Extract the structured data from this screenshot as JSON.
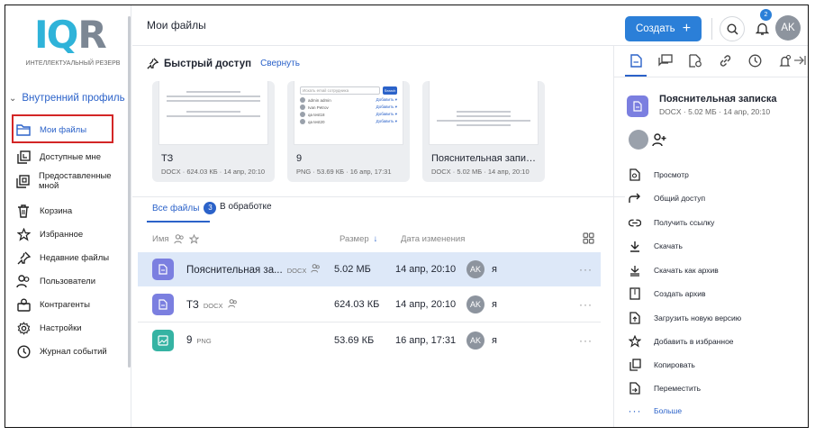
{
  "logo": {
    "mark_left": "IQ",
    "mark_right": "R",
    "subtitle": "Интеллектуальный резерв"
  },
  "sidebar": {
    "section": "Внутренний профиль",
    "items": [
      {
        "label": "Мои файлы",
        "icon": "folder-icon"
      },
      {
        "label": "Доступные мне",
        "icon": "shared-icon"
      },
      {
        "label": "Предоставленные мной",
        "icon": "provided-icon"
      },
      {
        "label": "Корзина",
        "icon": "trash-icon"
      },
      {
        "label": "Избранное",
        "icon": "star-icon"
      },
      {
        "label": "Недавние файлы",
        "icon": "pin-icon"
      },
      {
        "label": "Пользователи",
        "icon": "users-icon"
      },
      {
        "label": "Контрагенты",
        "icon": "counterparty-icon"
      },
      {
        "label": "Настройки",
        "icon": "settings-icon"
      },
      {
        "label": "Журнал событий",
        "icon": "clock-icon"
      }
    ]
  },
  "header": {
    "title": "Мои файлы",
    "create_label": "Создать",
    "notifications_count": "2",
    "user_initials": "AK"
  },
  "quick_access": {
    "title": "Быстрый доступ",
    "collapse_label": "Свернуть",
    "cards": [
      {
        "name": "ТЗ",
        "meta": "DOCX · 624.03 КБ · 14 апр, 20:10"
      },
      {
        "name": "9",
        "meta": "PNG · 53.69 КБ · 16 апр, 17:31",
        "preview": {
          "search_placeholder": "Искать email сотрудника",
          "search_button": "Search",
          "rows": [
            {
              "name": "admin admin",
              "link": "Добавить ▾"
            },
            {
              "name": "Ivan Petrov",
              "link": "Добавить ▾"
            },
            {
              "name": "qa test18",
              "link": "Добавить ▾"
            },
            {
              "name": "qa test20",
              "link": "Добавить ▾"
            }
          ]
        }
      },
      {
        "name": "Пояснительная записка",
        "meta": "DOCX · 5.02 МБ · 14 апр, 20:10"
      }
    ]
  },
  "tabs": [
    {
      "label": "Все файлы",
      "count": "3"
    },
    {
      "label": "В обработке"
    }
  ],
  "table": {
    "headers": {
      "name": "Имя",
      "size": "Размер",
      "date": "Дата изменения"
    },
    "rows": [
      {
        "name": "Пояснительная за...",
        "ext": "DOCX",
        "shared": true,
        "size": "5.02 МБ",
        "date": "14 апр, 20:10",
        "owner_initials": "AK",
        "owner": "я",
        "type": "doc"
      },
      {
        "name": "ТЗ",
        "ext": "DOCX",
        "shared": true,
        "size": "624.03 КБ",
        "date": "14 апр, 20:10",
        "owner_initials": "AK",
        "owner": "я",
        "type": "doc"
      },
      {
        "name": "9",
        "ext": "PNG",
        "shared": false,
        "size": "53.69 КБ",
        "date": "16 апр, 17:31",
        "owner_initials": "AK",
        "owner": "я",
        "type": "img"
      }
    ]
  },
  "details": {
    "file_name": "Пояснительная записка",
    "file_meta": "DOCX · 5.02 МБ · 14 апр, 20:10",
    "actions": [
      {
        "label": "Просмотр",
        "icon": "view-icon"
      },
      {
        "label": "Общий доступ",
        "icon": "share-icon"
      },
      {
        "label": "Получить ссылку",
        "icon": "link-icon"
      },
      {
        "label": "Скачать",
        "icon": "download-icon"
      },
      {
        "label": "Скачать как архив",
        "icon": "download-archive-icon"
      },
      {
        "label": "Создать архив",
        "icon": "archive-icon"
      },
      {
        "label": "Загрузить новую версию",
        "icon": "upload-version-icon"
      },
      {
        "label": "Добавить в избранное",
        "icon": "star-icon"
      },
      {
        "label": "Копировать",
        "icon": "copy-icon"
      },
      {
        "label": "Переместить",
        "icon": "move-icon"
      },
      {
        "label": "Больше",
        "icon": "more-icon"
      }
    ]
  },
  "colors": {
    "accent": "#2b62c9",
    "button": "#2b7fd8",
    "doc_icon": "#7b7fe0",
    "img_icon": "#35b3a3",
    "selected_row": "#dde8f8",
    "highlight_box": "#d32626"
  }
}
